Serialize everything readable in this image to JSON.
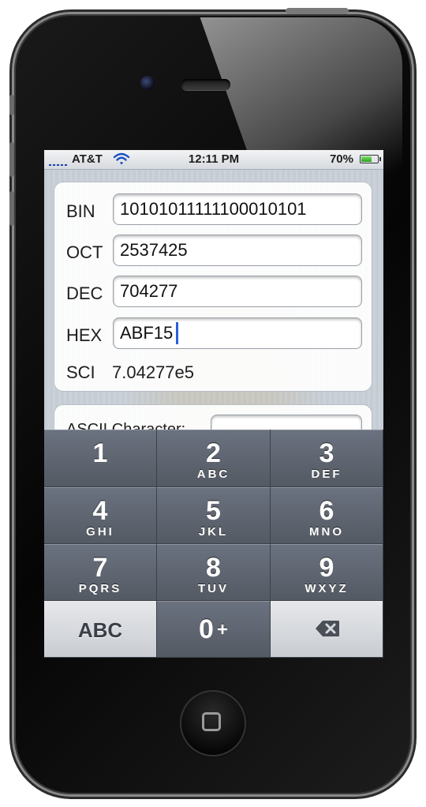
{
  "status_bar": {
    "carrier": "AT&T",
    "time": "12:11 PM",
    "battery_percent": "70%",
    "battery_level": 0.7,
    "icons": [
      "signal-icon",
      "wifi-icon",
      "battery-icon"
    ]
  },
  "fields": {
    "bin": {
      "label": "BIN",
      "value": "10101011111100010101"
    },
    "oct": {
      "label": "OCT",
      "value": "2537425"
    },
    "dec": {
      "label": "DEC",
      "value": "704277"
    },
    "hex": {
      "label": "HEX",
      "value": "ABF15"
    },
    "sci": {
      "label": "SCI",
      "value": "7.04277e5"
    }
  },
  "ascii": {
    "label": "ASCII Character:"
  },
  "keypad": {
    "keys": [
      {
        "num": "1",
        "letters": ""
      },
      {
        "num": "2",
        "letters": "ABC"
      },
      {
        "num": "3",
        "letters": "DEF"
      },
      {
        "num": "4",
        "letters": "GHI"
      },
      {
        "num": "5",
        "letters": "JKL"
      },
      {
        "num": "6",
        "letters": "MNO"
      },
      {
        "num": "7",
        "letters": "PQRS"
      },
      {
        "num": "8",
        "letters": "TUV"
      },
      {
        "num": "9",
        "letters": "WXYZ"
      }
    ],
    "abc_label": "ABC",
    "zero_label": "0",
    "zero_plus": "+",
    "delete_icon": "backspace-icon"
  },
  "colors": {
    "caret": "#2a5fdc",
    "key_dark": "#5d636c",
    "key_light": "#d6d9dd"
  }
}
